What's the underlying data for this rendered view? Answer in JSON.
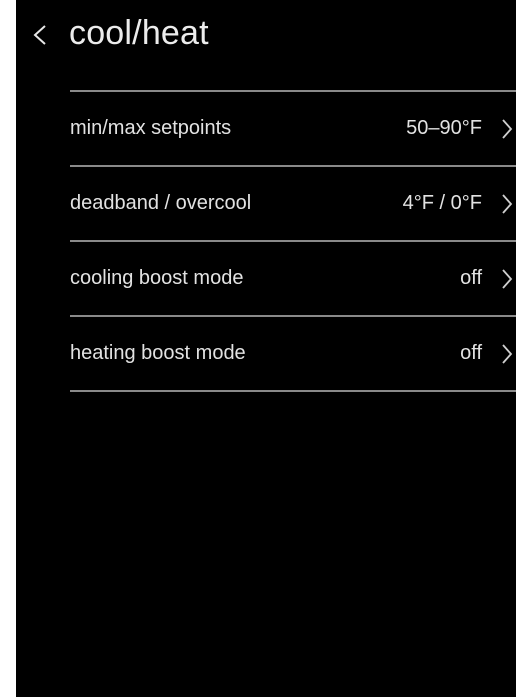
{
  "screen": {
    "title": "cool/heat",
    "back_icon": "chevron-left-icon"
  },
  "settings": [
    {
      "label": "min/max setpoints",
      "value": "50–90°F",
      "icon": "chevron-right-icon"
    },
    {
      "label": "deadband / overcool",
      "value": "4°F / 0°F",
      "icon": "chevron-right-icon"
    },
    {
      "label": "cooling boost mode",
      "value": "off",
      "icon": "chevron-right-icon"
    },
    {
      "label": "heating boost mode",
      "value": "off",
      "icon": "chevron-right-icon"
    }
  ],
  "colors": {
    "background": "#000000",
    "text": "#e6e6e6",
    "divider": "#8a8a8a"
  }
}
